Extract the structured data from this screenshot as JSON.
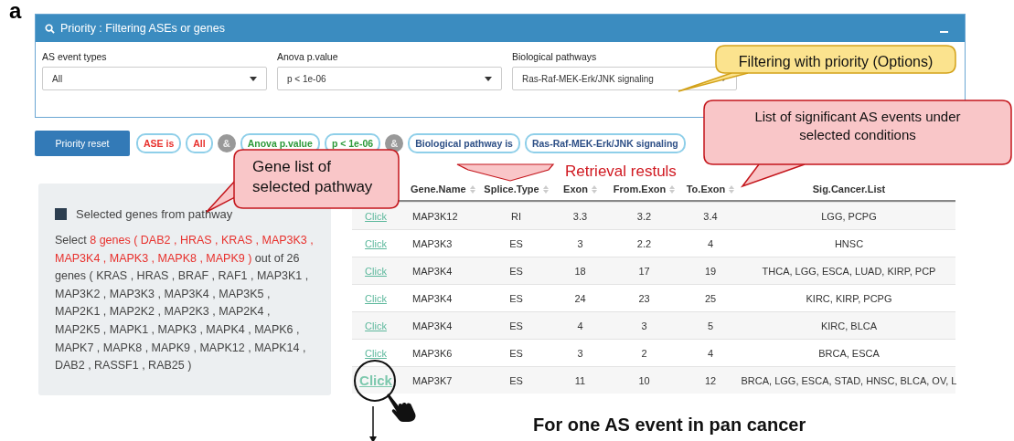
{
  "figure_label": "a",
  "filter_panel": {
    "title": "Priority : Filtering ASEs or genes",
    "filters": [
      {
        "label": "AS event types",
        "value": "All"
      },
      {
        "label": "Anova p.value",
        "value": "p < 1e-06"
      },
      {
        "label": "Biological pathways",
        "value": "Ras-Raf-MEK-Erk/JNK signaling"
      }
    ]
  },
  "reset_button": "Priority reset",
  "chips": [
    {
      "kind": "chip",
      "text": "ASE is",
      "color": "#e8302c"
    },
    {
      "kind": "chip",
      "text": "All",
      "color": "#e8302c"
    },
    {
      "kind": "separator",
      "text": "&"
    },
    {
      "kind": "chip",
      "text": "Anova p.value",
      "color": "#2e9a3a"
    },
    {
      "kind": "chip",
      "text": "p < 1e-06",
      "color": "#2e9a3a"
    },
    {
      "kind": "separator",
      "text": "&"
    },
    {
      "kind": "chip",
      "text": "Biological pathway is",
      "color": "#2d4f86"
    },
    {
      "kind": "chip",
      "text": "Ras-Raf-MEK-Erk/JNK signaling",
      "color": "#2d4f86"
    }
  ],
  "gene_panel": {
    "checked": true,
    "heading": "Selected genes from pathway",
    "description": [
      {
        "text": "Select ",
        "highlighted": false
      },
      {
        "text": "8 genes ( DAB2 , HRAS , KRAS , MAP3K3 , MAP3K4 , MAPK3 , MAPK8 , MAPK9 )",
        "highlighted": true
      },
      {
        "text": " out of 26 genes ( KRAS , HRAS , BRAF , RAF1 , MAP3K1 , MAP3K2 , MAP3K3 , MAP3K4 , MAP3K5 , MAP2K1 , MAP2K2 , MAP2K3 , MAP2K4 , MAP2K5 , MAPK1 , MAPK3 , MAPK4 , MAPK6 , MAPK7 , MAPK8 , MAPK9 , MAPK12 , MAPK14 , DAB2 , RASSF1 , RAB25 )",
        "highlighted": false
      }
    ]
  },
  "table": {
    "columns": [
      {
        "label": "Gene.Name",
        "sortable": true
      },
      {
        "label": "Splice.Type",
        "sortable": true
      },
      {
        "label": "Exon",
        "sortable": true
      },
      {
        "label": "From.Exon",
        "sortable": true
      },
      {
        "label": "To.Exon",
        "sortable": true
      },
      {
        "label": "Sig.Cancer.List",
        "sortable": false
      }
    ],
    "rows": [
      {
        "link": "Click",
        "magnified": false,
        "cells": [
          "MAP3K12",
          "RI",
          "3.3",
          "3.2",
          "3.4",
          "LGG, PCPG"
        ]
      },
      {
        "link": "Click",
        "magnified": false,
        "cells": [
          "MAP3K3",
          "ES",
          "3",
          "2.2",
          "4",
          "HNSC"
        ]
      },
      {
        "link": "Click",
        "magnified": false,
        "cells": [
          "MAP3K4",
          "ES",
          "18",
          "17",
          "19",
          "THCA, LGG, ESCA, LUAD, KIRP, PCP"
        ]
      },
      {
        "link": "Click",
        "magnified": false,
        "cells": [
          "MAP3K4",
          "ES",
          "24",
          "23",
          "25",
          "KIRC, KIRP, PCPG"
        ]
      },
      {
        "link": "Click",
        "magnified": false,
        "cells": [
          "MAP3K4",
          "ES",
          "4",
          "3",
          "5",
          "KIRC, BLCA"
        ]
      },
      {
        "link": "Click",
        "magnified": false,
        "cells": [
          "MAP3K6",
          "ES",
          "3",
          "2",
          "4",
          "BRCA, ESCA"
        ]
      },
      {
        "link": "Click",
        "magnified": true,
        "cells": [
          "MAP3K7",
          "ES",
          "11",
          "10",
          "12",
          "BRCA, LGG, ESCA, STAD, HNSC, BLCA, OV, L"
        ]
      }
    ]
  },
  "callouts": [
    {
      "kind": "note",
      "text": "Filtering with priority (Options)"
    },
    {
      "kind": "alert",
      "text": "List of significant AS events under selected conditions"
    },
    {
      "kind": "alert",
      "text": "Gene list of selected pathway"
    }
  ],
  "retrieval_label": "Retrieval restuls",
  "caption": "For one AS event in pan cancer"
}
